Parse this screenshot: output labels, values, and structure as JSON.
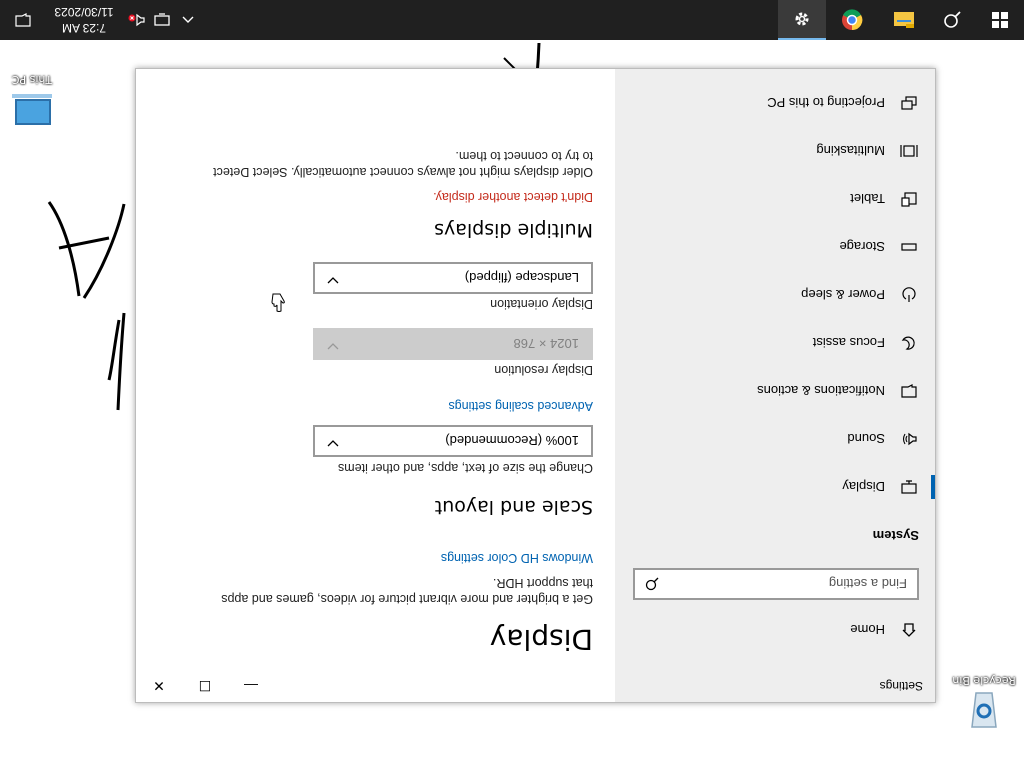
{
  "desktop": {
    "icons": [
      {
        "label": "This PC"
      },
      {
        "label": "Recycle Bin"
      }
    ]
  },
  "taskbar": {
    "time": "7:23 AM",
    "date": "11/30/2023",
    "start_icon": "windows-logo-icon",
    "search_icon": "search-icon"
  },
  "window": {
    "title": "Settings",
    "controls": {
      "minimize": "—",
      "maximize": "☐",
      "close": "✕"
    }
  },
  "sidebar": {
    "home_label": "Home",
    "search_placeholder": "Find a setting",
    "section": "System",
    "items": [
      {
        "label": "Display",
        "icon": "display-icon"
      },
      {
        "label": "Sound",
        "icon": "speaker-icon"
      },
      {
        "label": "Notifications & actions",
        "icon": "notification-icon"
      },
      {
        "label": "Focus assist",
        "icon": "moon-icon"
      },
      {
        "label": "Power & sleep",
        "icon": "power-icon"
      },
      {
        "label": "Storage",
        "icon": "storage-icon"
      },
      {
        "label": "Tablet",
        "icon": "tablet-icon"
      },
      {
        "label": "Multitasking",
        "icon": "multitasking-icon"
      },
      {
        "label": "Projecting to this PC",
        "icon": "projector-icon"
      }
    ]
  },
  "content": {
    "title": "Display",
    "hdr_desc_line1": "Get a brighter and more vibrant picture for videos, games and apps",
    "hdr_desc_line2": "that support HDR.",
    "hdr_link": "Windows HD Color settings",
    "scale_heading": "Scale and layout",
    "scale_label": "Change the size of text, apps, and other items",
    "scale_value": "100% (Recommended)",
    "advanced_link": "Advanced scaling settings",
    "resolution_label": "Display resolution",
    "resolution_value": "1024 × 768",
    "orientation_label": "Display orientation",
    "orientation_value": "Landscape (flipped)",
    "multi_heading": "Multiple displays",
    "multi_error": "Didn't detect another display.",
    "multi_desc_line1": "Older displays might not always connect automatically. Select Detect",
    "multi_desc_line2": "to try to connect to them."
  },
  "colors": {
    "accent": "#0063b1",
    "error": "#c42b1c",
    "taskbar": "#202020",
    "sidebar": "#eeeeee"
  }
}
